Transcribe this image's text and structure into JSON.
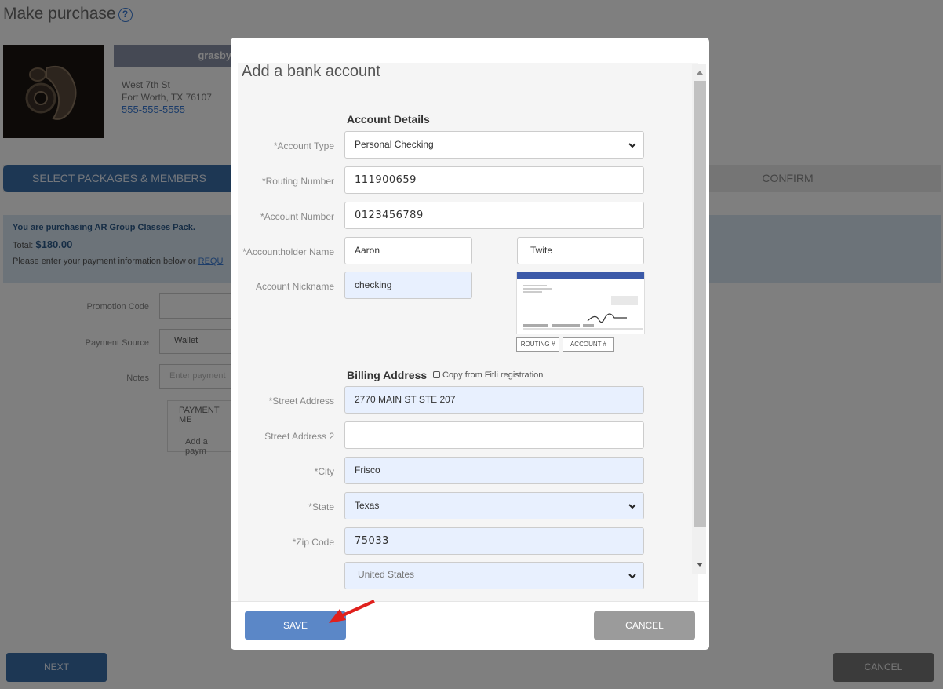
{
  "background": {
    "page_title": "Make purchase",
    "gym": {
      "name": "grasby",
      "street": "West 7th St",
      "city_state": "Fort Worth, TX 76107",
      "phone": "555-555-5555"
    },
    "steps": {
      "active": "SELECT PACKAGES & MEMBERS",
      "confirm": "CONFIRM"
    },
    "info": {
      "purchasing": "You are purchasing AR Group Classes Pack.",
      "total_label": "Total:",
      "total_value": "$180.00",
      "payment_prefix": "Please enter your payment information below or",
      "payment_link": "REQU"
    },
    "form": {
      "promotion_label": "Promotion Code",
      "payment_source_label": "Payment Source",
      "payment_source_value": "Wallet",
      "notes_label": "Notes",
      "notes_placeholder": "Enter payment",
      "payment_methods_header": "PAYMENT ME",
      "add_payment": "Add a paym"
    },
    "next_label": "NEXT",
    "cancel_label": "CANCEL"
  },
  "modal": {
    "title": "Add a bank account",
    "account_details": {
      "section_title": "Account Details",
      "account_type_label": "*Account Type",
      "account_type_value": "Personal Checking",
      "routing_label": "*Routing Number",
      "routing_value": "111900659",
      "account_number_label": "*Account Number",
      "account_number_value": "0123456789",
      "holder_label": "*Accountholder Name",
      "holder_first": "Aaron",
      "holder_last": "Twite",
      "nickname_label": "Account Nickname",
      "nickname_value": "checking",
      "check_routing_tag": "ROUTING #",
      "check_account_tag": "ACCOUNT #"
    },
    "billing": {
      "section_title": "Billing Address",
      "copy_label": "Copy from Fitli registration",
      "street_label": "*Street Address",
      "street_value": "2770 MAIN ST STE 207",
      "street2_label": "Street Address 2",
      "street2_value": "",
      "city_label": "*City",
      "city_value": "Frisco",
      "state_label": "*State",
      "state_value": "Texas",
      "zip_label": "*Zip Code",
      "zip_value": "75033",
      "country_value": "United States"
    },
    "save_label": "SAVE",
    "cancel_label": "CANCEL"
  }
}
